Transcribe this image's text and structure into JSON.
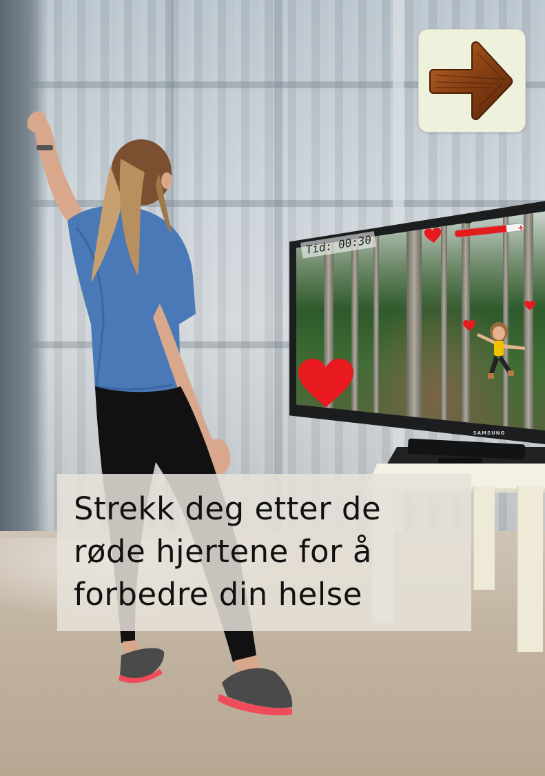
{
  "game": {
    "timer_text": "Tid: 00:30",
    "health_fraction": 0.75,
    "health_minus": "−",
    "health_plus": "+"
  },
  "tv": {
    "brand": "SAMSUNG"
  },
  "navigation": {
    "next_icon": "wooden-arrow-right-icon"
  },
  "caption": {
    "lines": [
      "Strekk deg etter de",
      "røde hjertene for å",
      "forbedre din helse"
    ]
  },
  "colors": {
    "heart": "#e8191f",
    "caption_bg": "#e6e2da",
    "button_bg": "#eef1dc"
  }
}
